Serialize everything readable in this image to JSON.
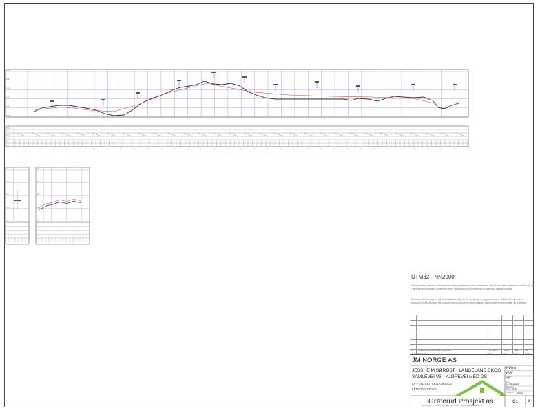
{
  "sheet": {
    "datum": "UTM32 - NN2000",
    "notes": [
      "Alle plassering utleders i søknaden er utførlig registrert samt koordinatsatt. I Fakta-frem etter reglement / merket Pp og I tillegg er koordinatsatt for flere punkter. Høydekoter og terrengprofil er basert på digitale kartdata.",
      "Eksisterende ledninger er påvist i marka så langt det er mulig. Dybde og plassering er usikker. Entreprenør er ansvarlig for å kontrollere alle eksisterende ledninger før arbeid starter, samt varsle eiere av kabler og ledninger."
    ],
    "revisions": {
      "rows": [
        {
          "rev": "B",
          "text": "TEGNINGSREV. PROSJ. FRE. HUS",
          "date": "07.02.23",
          "by": "TN/OG",
          "ctrl": "TMS",
          "app": "CG"
        },
        {
          "rev": "Rev.",
          "text": "Beskrivelse",
          "date": "Dato",
          "by": "Tegn.",
          "ctrl": "Kontr.",
          "app": "Godkj."
        }
      ]
    },
    "title_block": {
      "client": "JM NORGE AS",
      "project_line1": "JESSHEIM SØRØST - LANGELAND SKOG",
      "project_line2": "SAMLEVEI V3 - KJØREVEI MED GS",
      "subtitle1": "OFFENTLIG VEGANLEGG",
      "subtitle2": "LENGDEPROFIL",
      "firm": "Grøterud Prosjekt  as",
      "firm_address": "ORSKOG - Tlf: 64 80 04 50 - Mob 913 48 613 - E-post: post@groterud.no",
      "fields": [
        {
          "label": "Tegnet",
          "value": "TN/OG"
        },
        {
          "label": "Kontrollert",
          "value": "TMS"
        },
        {
          "label": "Godkjent",
          "value": "CG"
        },
        {
          "label": "Dato",
          "value": "27.01.2023"
        },
        {
          "label": "Målestokk",
          "value": "H=1:1000"
        },
        {
          "label": "Prosjektnr.",
          "value": "2206"
        }
      ],
      "drawing_no": "C1",
      "revision": "A"
    }
  },
  "profiles": {
    "main_y_ticks": [
      "150",
      "140",
      "130",
      "120",
      "110",
      "100"
    ],
    "main_chainage": [
      "0",
      "20",
      "40",
      "60",
      "80",
      "100",
      "120",
      "140",
      "160",
      "180",
      "200",
      "220",
      "240",
      "260",
      "280",
      "300",
      "320",
      "340",
      "360",
      "380",
      "400",
      "420",
      "440",
      "460",
      "480",
      "500",
      "520",
      "540",
      "560",
      "580",
      "600",
      "620",
      "640",
      "660"
    ],
    "main_row_labels": [
      "Stign.",
      "Vert.",
      "Kurv.",
      "Tverr.",
      "Terr.",
      "Prof."
    ],
    "small_y_ticks": [
      "150",
      "140",
      "130",
      "120",
      "110"
    ]
  },
  "colors": {
    "grid": "#6b6bd6",
    "terrain": "#333333",
    "design": "#d63a3a",
    "frame": "#444444"
  }
}
